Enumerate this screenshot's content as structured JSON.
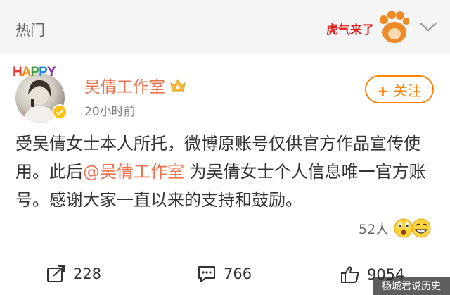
{
  "header": {
    "title": "热门",
    "promo_text": "虎气来了"
  },
  "post": {
    "avatar_badge": "HAPPY",
    "author": "吴倩工作室",
    "time": "20小时前",
    "follow_label": "+ 关注",
    "content": {
      "before": "受吴倩女士本人所托，微博原账号仅供官方作品宣传使用。此后",
      "mention": "@吴倩工作室",
      "after": " 为吴倩女士个人信息唯一官方账号。感谢大家一直以来的支持和鼓励。"
    },
    "reactions": {
      "count": "52人"
    }
  },
  "actions": {
    "repost": "228",
    "comment": "766",
    "like": "9054"
  },
  "watermark": "杨城君说历史",
  "colors": {
    "accent": "#eb7350",
    "follow": "#ff8200",
    "verify": "#ffc10d"
  },
  "icons": {
    "dropdown": "chevron-down-icon",
    "verify": "verified-badge-icon",
    "member": "crown-icon",
    "repost": "repost-icon",
    "comment": "comment-icon",
    "like": "thumbs-up-icon"
  }
}
